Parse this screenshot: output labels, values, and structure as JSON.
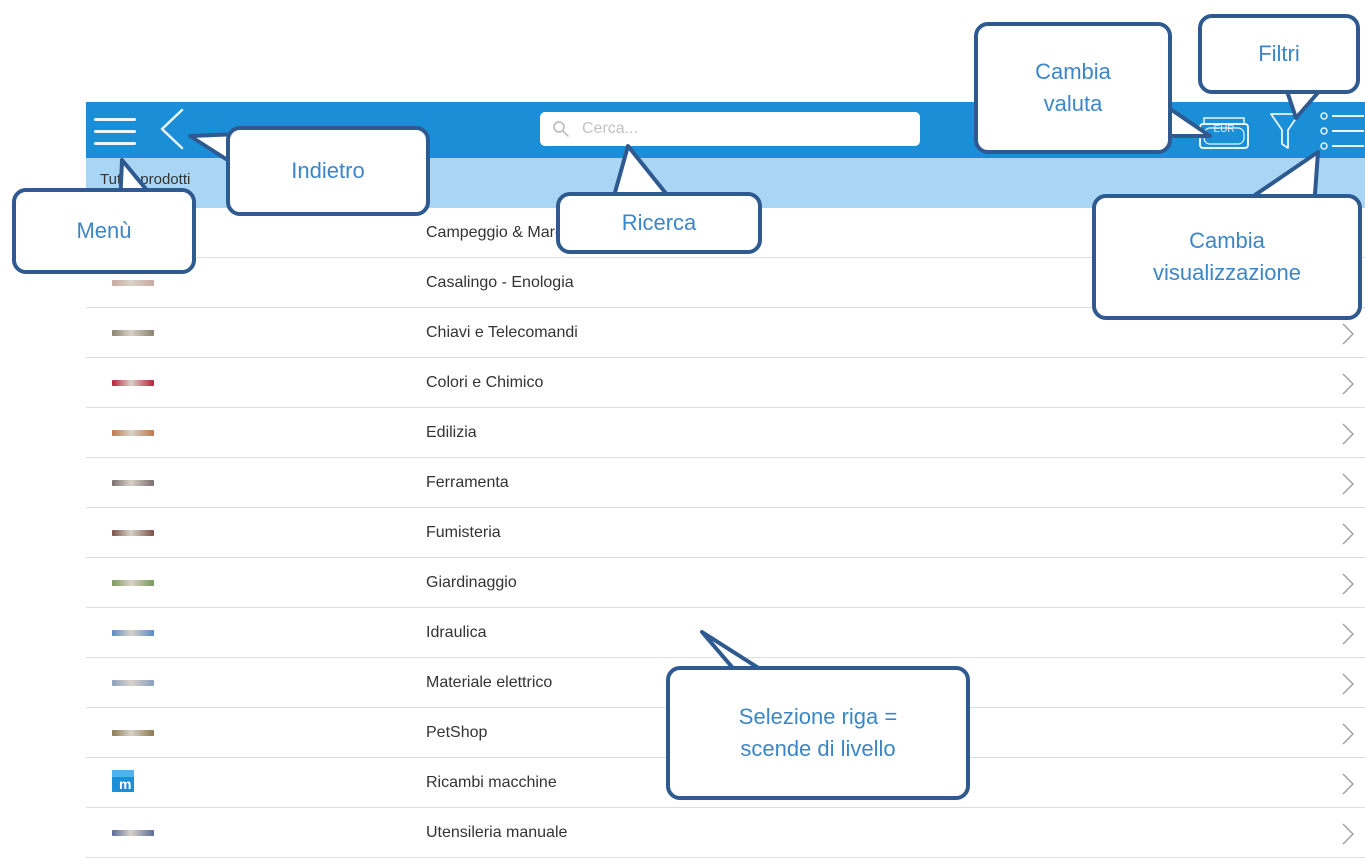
{
  "header": {
    "search_placeholder": "Cerca...",
    "currency_label": "EUR",
    "bar_color": "#1a8fd8"
  },
  "breadcrumb": {
    "text": "Tutti i prodotti"
  },
  "list": {
    "rows": [
      {
        "label": "Campeggio & Mare",
        "thumb_color": "#9a9a7a"
      },
      {
        "label": "Casalingo - Enologia",
        "thumb_color": "#c9a9a0"
      },
      {
        "label": "Chiavi e Telecomandi",
        "thumb_color": "#8a8270"
      },
      {
        "label": "Colori e Chimico",
        "thumb_color": "#b8203a"
      },
      {
        "label": "Edilizia",
        "thumb_color": "#c0784a"
      },
      {
        "label": "Ferramenta",
        "thumb_color": "#7a6e70"
      },
      {
        "label": "Fumisteria",
        "thumb_color": "#7a5048"
      },
      {
        "label": "Giardinaggio",
        "thumb_color": "#7a9a5a"
      },
      {
        "label": "Idraulica",
        "thumb_color": "#5a8ac8"
      },
      {
        "label": "Materiale elettrico",
        "thumb_color": "#8aa0c0"
      },
      {
        "label": "PetShop",
        "thumb_color": "#8a7a50"
      },
      {
        "label": "Ricambi macchine",
        "thumb_color": "#1a8fd8"
      },
      {
        "label": "Utensileria manuale",
        "thumb_color": "#5a6a9a"
      }
    ]
  },
  "callouts": {
    "menu": "Menù",
    "back": "Indietro",
    "search": "Ricerca",
    "currency_line1": "Cambia",
    "currency_line2": "valuta",
    "filters": "Filtri",
    "view_line1": "Cambia",
    "view_line2": "visualizzazione",
    "row_line1": "Selezione riga =",
    "row_line2": "scende di livello"
  },
  "colors": {
    "accent": "#1a8fd8",
    "breadcrumb_bg": "#a8d6f4",
    "callout_border": "#2f5a8f",
    "callout_text": "#3c86c8"
  }
}
